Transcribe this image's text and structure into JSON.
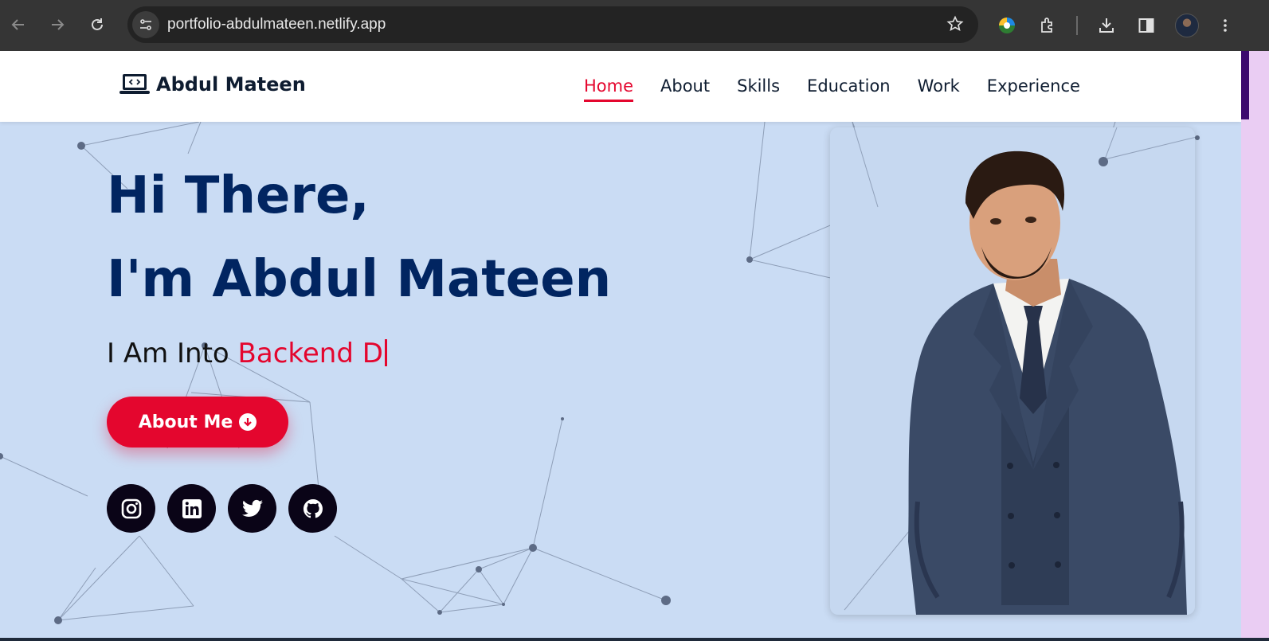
{
  "browser": {
    "url": "portfolio-abdulmateen.netlify.app",
    "back_icon": "arrow-left-icon",
    "forward_icon": "arrow-right-icon",
    "reload_icon": "reload-icon"
  },
  "site": {
    "brand": "Abdul Mateen",
    "nav": {
      "home": "Home",
      "about": "About",
      "skills": "Skills",
      "education": "Education",
      "work": "Work",
      "experience": "Experience"
    }
  },
  "hero": {
    "greeting": "Hi There,",
    "name_line": "I'm Abdul Mateen",
    "typed_prefix": "I Am Into ",
    "typed_value": "Backend D",
    "about_button": "About Me"
  },
  "colors": {
    "accent": "#e4062e",
    "heading": "#012561",
    "background": "#cadcf4",
    "social_bg": "#0a0417"
  },
  "socials": [
    "instagram-icon",
    "linkedin-icon",
    "twitter-icon",
    "github-icon"
  ]
}
